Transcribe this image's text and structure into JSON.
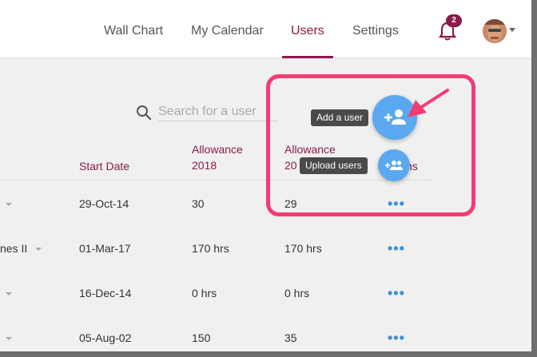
{
  "nav": {
    "tabs": [
      {
        "label": "Wall Chart"
      },
      {
        "label": "My Calendar"
      },
      {
        "label": "Users"
      },
      {
        "label": "Settings"
      }
    ],
    "notification_count": "2"
  },
  "search": {
    "placeholder": "Search for a user"
  },
  "table": {
    "headers": {
      "start_date": "Start Date",
      "allowance_2018_line1": "Allowance",
      "allowance_2018_line2": "2018",
      "allowance_next_line1": "Allowance",
      "allowance_next_line2": "20",
      "actions_partial": "ns"
    },
    "rows": [
      {
        "name": "",
        "start_date": "29-Oct-14",
        "allowance_a": "30",
        "allowance_b": "29",
        "actions": "•••"
      },
      {
        "name": "nes II",
        "start_date": "01-Mar-17",
        "allowance_a": "170 hrs",
        "allowance_b": "170 hrs",
        "actions": "•••"
      },
      {
        "name": "",
        "start_date": "16-Dec-14",
        "allowance_a": "0 hrs",
        "allowance_b": "0 hrs",
        "actions": "•••"
      },
      {
        "name": "",
        "start_date": "05-Aug-02",
        "allowance_a": "150",
        "allowance_b": "35",
        "actions": "•••"
      }
    ]
  },
  "fabs": {
    "add_user_tooltip": "Add a user",
    "upload_users_tooltip": "Upload users"
  },
  "colors": {
    "accent": "#8a1a4a",
    "fab": "#5aa8ef",
    "highlight": "#f23c72",
    "link": "#3b8fe0"
  }
}
